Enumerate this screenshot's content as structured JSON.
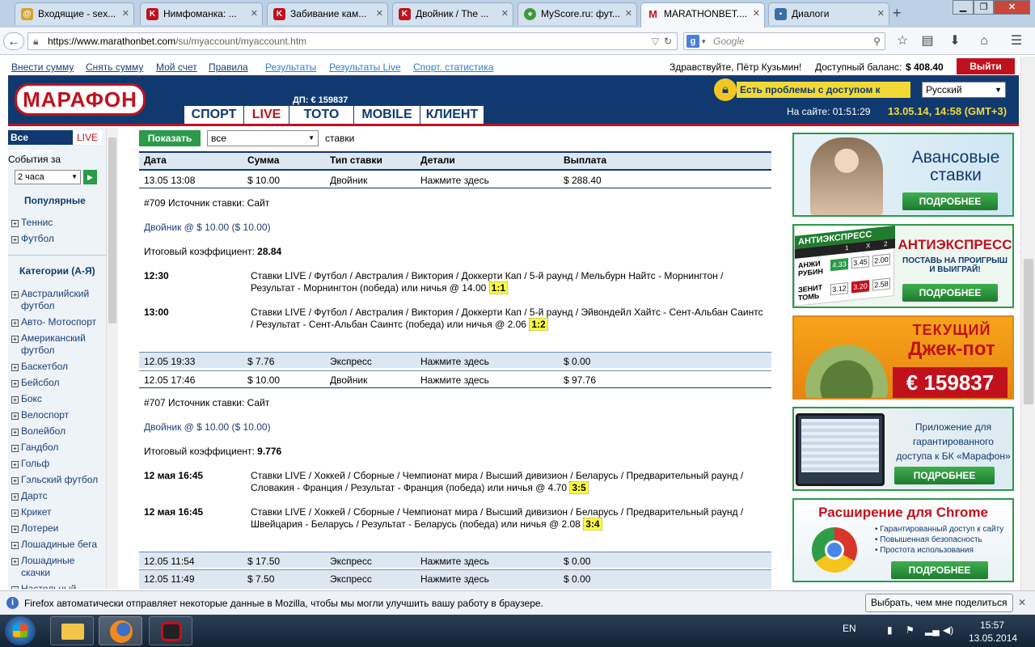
{
  "browser": {
    "tabs": [
      {
        "label": "Входящие - sex...",
        "icon": "mail-icon",
        "color": "#d4a52b"
      },
      {
        "label": "Нимфоманка: ...",
        "icon": "k-site-icon",
        "color": "#c1111d"
      },
      {
        "label": "Забивание кам...",
        "icon": "k-site-icon",
        "color": "#c1111d"
      },
      {
        "label": "Двойник / The ...",
        "icon": "k-site-icon",
        "color": "#c1111d"
      },
      {
        "label": "MyScore.ru: фут...",
        "icon": "myscore-icon",
        "color": "#3d9a3d"
      },
      {
        "label": "MARATHONBET....",
        "icon": "marathon-icon",
        "color": "#c1111d"
      },
      {
        "label": "Диалоги",
        "icon": "vk-icon",
        "color": "#3b6ea5"
      }
    ],
    "url_host": "https://www.marathonbet.com",
    "url_path": "/su/myaccount/myaccount.htm",
    "search_placeholder": "Google"
  },
  "site": {
    "top_links": [
      "Внести сумму",
      "Снять сумму",
      "Мой счет",
      "Правила",
      "Результаты",
      "Результаты Live",
      "Спорт. статистика"
    ],
    "greeting": "Здравствуйте, Пётр Кузьмин!",
    "balance_label": "Доступный баланс:",
    "balance_value": "$ 408.40",
    "logout": "Выйти",
    "logo": "МАРАФОН",
    "dp": "ДП: € 159837",
    "main_tabs": [
      "СПОРТ",
      "LIVE",
      "ТОТО",
      "MOBILE",
      "КЛИЕНТ"
    ],
    "access_problem": "Есть проблемы с доступом к сайту?",
    "language": "Русский",
    "online_label": "На сайте: 01:51:29",
    "datetime": "13.05.14, 14:58 (GMT+3)"
  },
  "sidebar": {
    "all_events": "Все события",
    "live": "LIVE",
    "events_for": "События за",
    "period": "2 часа",
    "popular": "Популярные",
    "popular_items": [
      "Теннис",
      "Футбол"
    ],
    "categories_title": "Категории (А-Я)",
    "categories": [
      {
        "l1": "Австралийский",
        "l2": "футбол"
      },
      {
        "l1": "Авто- Мотоспорт",
        "l2": ""
      },
      {
        "l1": "Американский",
        "l2": "футбол"
      },
      {
        "l1": "Баскетбол",
        "l2": ""
      },
      {
        "l1": "Бейсбол",
        "l2": ""
      },
      {
        "l1": "Бокс",
        "l2": ""
      },
      {
        "l1": "Велоспорт",
        "l2": ""
      },
      {
        "l1": "Волейбол",
        "l2": ""
      },
      {
        "l1": "Гандбол",
        "l2": ""
      },
      {
        "l1": "Гольф",
        "l2": ""
      },
      {
        "l1": "Гэльский футбол",
        "l2": ""
      },
      {
        "l1": "Дартс",
        "l2": ""
      },
      {
        "l1": "Крикет",
        "l2": ""
      },
      {
        "l1": "Лотереи",
        "l2": ""
      },
      {
        "l1": "Лошадиные бега",
        "l2": ""
      },
      {
        "l1": "Лошадиные",
        "l2": "скачки"
      },
      {
        "l1": "Настольный",
        "l2": ""
      }
    ]
  },
  "filter": {
    "show_button": "Показать",
    "select_value": "все",
    "suffix": "ставки"
  },
  "table": {
    "headers": [
      "Дата",
      "Сумма",
      "Тип ставки",
      "Детали",
      "Выплата"
    ],
    "click_here": "Нажмите здесь"
  },
  "bets": {
    "b1": {
      "date": "13.05 13:08",
      "sum": "$ 10.00",
      "type": "Двойник",
      "payout": "$ 288.40",
      "source": "#709 Источник ставки: Сайт",
      "summary": "Двойник @ $ 10.00 ($ 10.00)",
      "coef_label": "Итоговый коэффициент:",
      "coef": "28.84",
      "legs": [
        {
          "time": "12:30",
          "l1": "Ставки LIVE / Футбол / Австралия / Виктория / Доккерти Кап / 5-й раунд / Мельбурн Найтс - Морнингтон /",
          "l2": "Результат - Морнингтон (победа) или ничья @ 14.00",
          "score": "1:1"
        },
        {
          "time": "13:00",
          "l1": "Ставки LIVE / Футбол / Австралия / Виктория / Доккерти Кап / 5-й раунд / Эйвондейл Хайтс - Сент-Альбан Саинтс",
          "l2": "/ Результат - Сент-Альбан Саинтс (победа) или ничья @ 2.06",
          "score": "1:2"
        }
      ]
    },
    "b2": {
      "date": "12.05 19:33",
      "sum": "$ 7.76",
      "type": "Экспресс",
      "payout": "$ 0.00"
    },
    "b3": {
      "date": "12.05 17:46",
      "sum": "$ 10.00",
      "type": "Двойник",
      "payout": "$ 97.76",
      "source": "#707 Источник ставки: Сайт",
      "summary": "Двойник @ $ 10.00 ($ 10.00)",
      "coef_label": "Итоговый коэффициент:",
      "coef": "9.776",
      "legs": [
        {
          "time": "12 мая 16:45",
          "l1": "Ставки LIVE / Хоккей / Сборные / Чемпионат мира / Высший дивизион / Беларусь / Предварительный раунд /",
          "l2": "Словакия - Франция / Результат - Франция (победа) или ничья @ 4.70",
          "score": "3:5"
        },
        {
          "time": "12 мая 16:45",
          "l1": "Ставки LIVE / Хоккей / Сборные / Чемпионат мира / Высший дивизион / Беларусь / Предварительный раунд /",
          "l2": "Швейцария - Беларусь / Результат - Беларусь (победа) или ничья @ 2.08",
          "score": "3:4"
        }
      ]
    },
    "b4": {
      "date": "12.05 11:54",
      "sum": "$ 17.50",
      "type": "Экспресс",
      "payout": "$ 0.00"
    },
    "b5": {
      "date": "12.05 11:49",
      "sum": "$ 7.50",
      "type": "Экспресс",
      "payout": "$ 0.00"
    }
  },
  "banners": {
    "b1": {
      "title1": "Авансовые",
      "title2": "ставки",
      "btn": "ПОДРОБНЕЕ"
    },
    "b2": {
      "card_title": "АНТИЭКСПРЕСС",
      "cols": [
        "1",
        "X",
        "2"
      ],
      "row1": {
        "t1": "АНЖИ",
        "t2": "РУБИН",
        "o": [
          "4.33",
          "3.45",
          "2.00"
        ]
      },
      "row2": {
        "t1": "ЗЕНИТ",
        "t2": "ТОМЬ",
        "o": [
          "3.12",
          "3.20",
          "2.58"
        ]
      },
      "title": "АНТИЭКСПРЕСС",
      "sub1": "ПОСТАВЬ НА ПРОИГРЫШ",
      "sub2": "И ВЫИГРАЙ!",
      "btn": "ПОДРОБНЕЕ"
    },
    "b3": {
      "t1": "ТЕКУЩИЙ",
      "t2": "Джек-пот",
      "amount": "€ 159837"
    },
    "b4": {
      "l1": "Приложение для",
      "l2": "гарантированного",
      "l3": "доступа к БК «Марафон»",
      "btn": "ПОДРОБНЕЕ"
    },
    "b5": {
      "title": "Расширение для Chrome",
      "items": [
        "• Гарантированный доступ к сайту",
        "• Повышенная безопасность",
        "• Простота использования"
      ],
      "btn": "ПОДРОБНЕЕ"
    }
  },
  "notification": {
    "text": "Firefox автоматически отправляет некоторые данные в Mozilla, чтобы мы могли улучшить вашу работу в браузере.",
    "button": "Выбрать, чем мне поделиться"
  },
  "taskbar": {
    "lang": "EN",
    "time": "15:57",
    "date": "13.05.2014"
  }
}
